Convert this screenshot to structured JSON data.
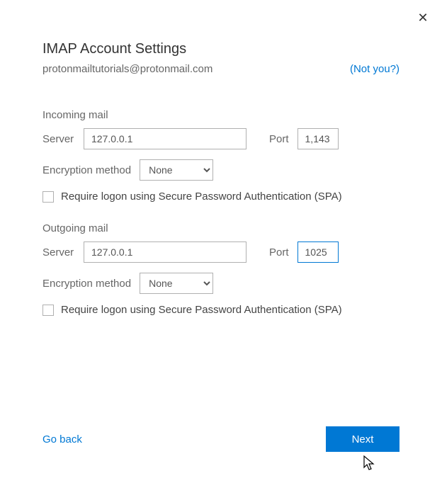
{
  "close_label": "✕",
  "title": "IMAP Account Settings",
  "email": "protonmailtutorials@protonmail.com",
  "not_you": "(Not you?)",
  "incoming": {
    "heading": "Incoming mail",
    "server_label": "Server",
    "server_value": "127.0.0.1",
    "port_label": "Port",
    "port_value": "1,143",
    "encryption_label": "Encryption method",
    "encryption_value": "None",
    "spa_label": "Require logon using Secure Password Authentication (SPA)"
  },
  "outgoing": {
    "heading": "Outgoing mail",
    "server_label": "Server",
    "server_value": "127.0.0.1",
    "port_label": "Port",
    "port_value": "1025",
    "encryption_label": "Encryption method",
    "encryption_value": "None",
    "spa_label": "Require logon using Secure Password Authentication (SPA)"
  },
  "go_back": "Go back",
  "next": "Next"
}
